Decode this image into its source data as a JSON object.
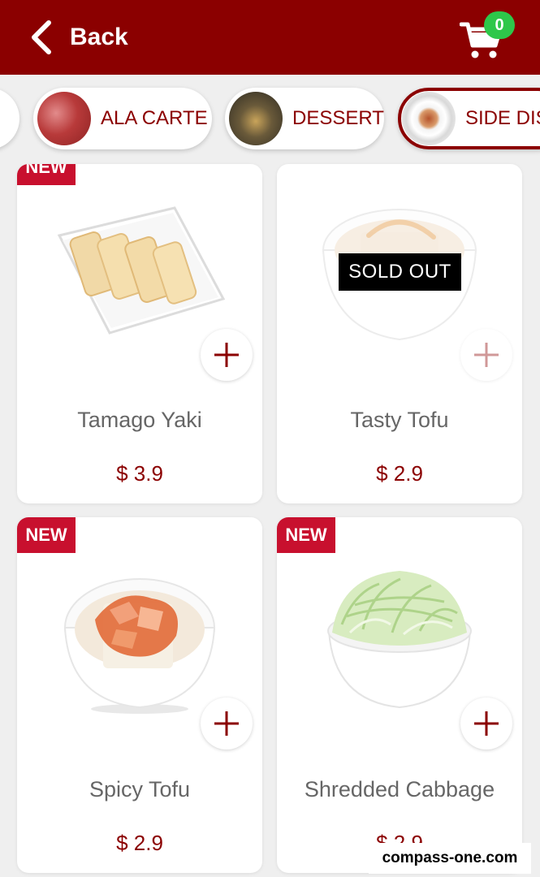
{
  "header": {
    "back_label": "Back",
    "cart_count": "0",
    "brand_color": "#8b0000",
    "badge_color": "#2ec74a"
  },
  "categories": [
    {
      "label": "",
      "active": false
    },
    {
      "label": "ALA CARTE",
      "active": false
    },
    {
      "label": "DESSERT",
      "active": false
    },
    {
      "label": "SIDE DISH",
      "active": true
    }
  ],
  "products": [
    {
      "name": "Tamago Yaki",
      "price": "$ 3.9",
      "badge": "NEW",
      "sold_out": false
    },
    {
      "name": "Tasty Tofu",
      "price": "$ 2.9",
      "badge": "",
      "sold_out": true,
      "sold_out_label": "SOLD OUT"
    },
    {
      "name": "Spicy Tofu",
      "price": "$ 2.9",
      "badge": "NEW",
      "sold_out": false
    },
    {
      "name": "Shredded Cabbage",
      "price": "$ 2.9",
      "badge": "NEW",
      "sold_out": false
    }
  ],
  "watermark": "compass-one.com"
}
